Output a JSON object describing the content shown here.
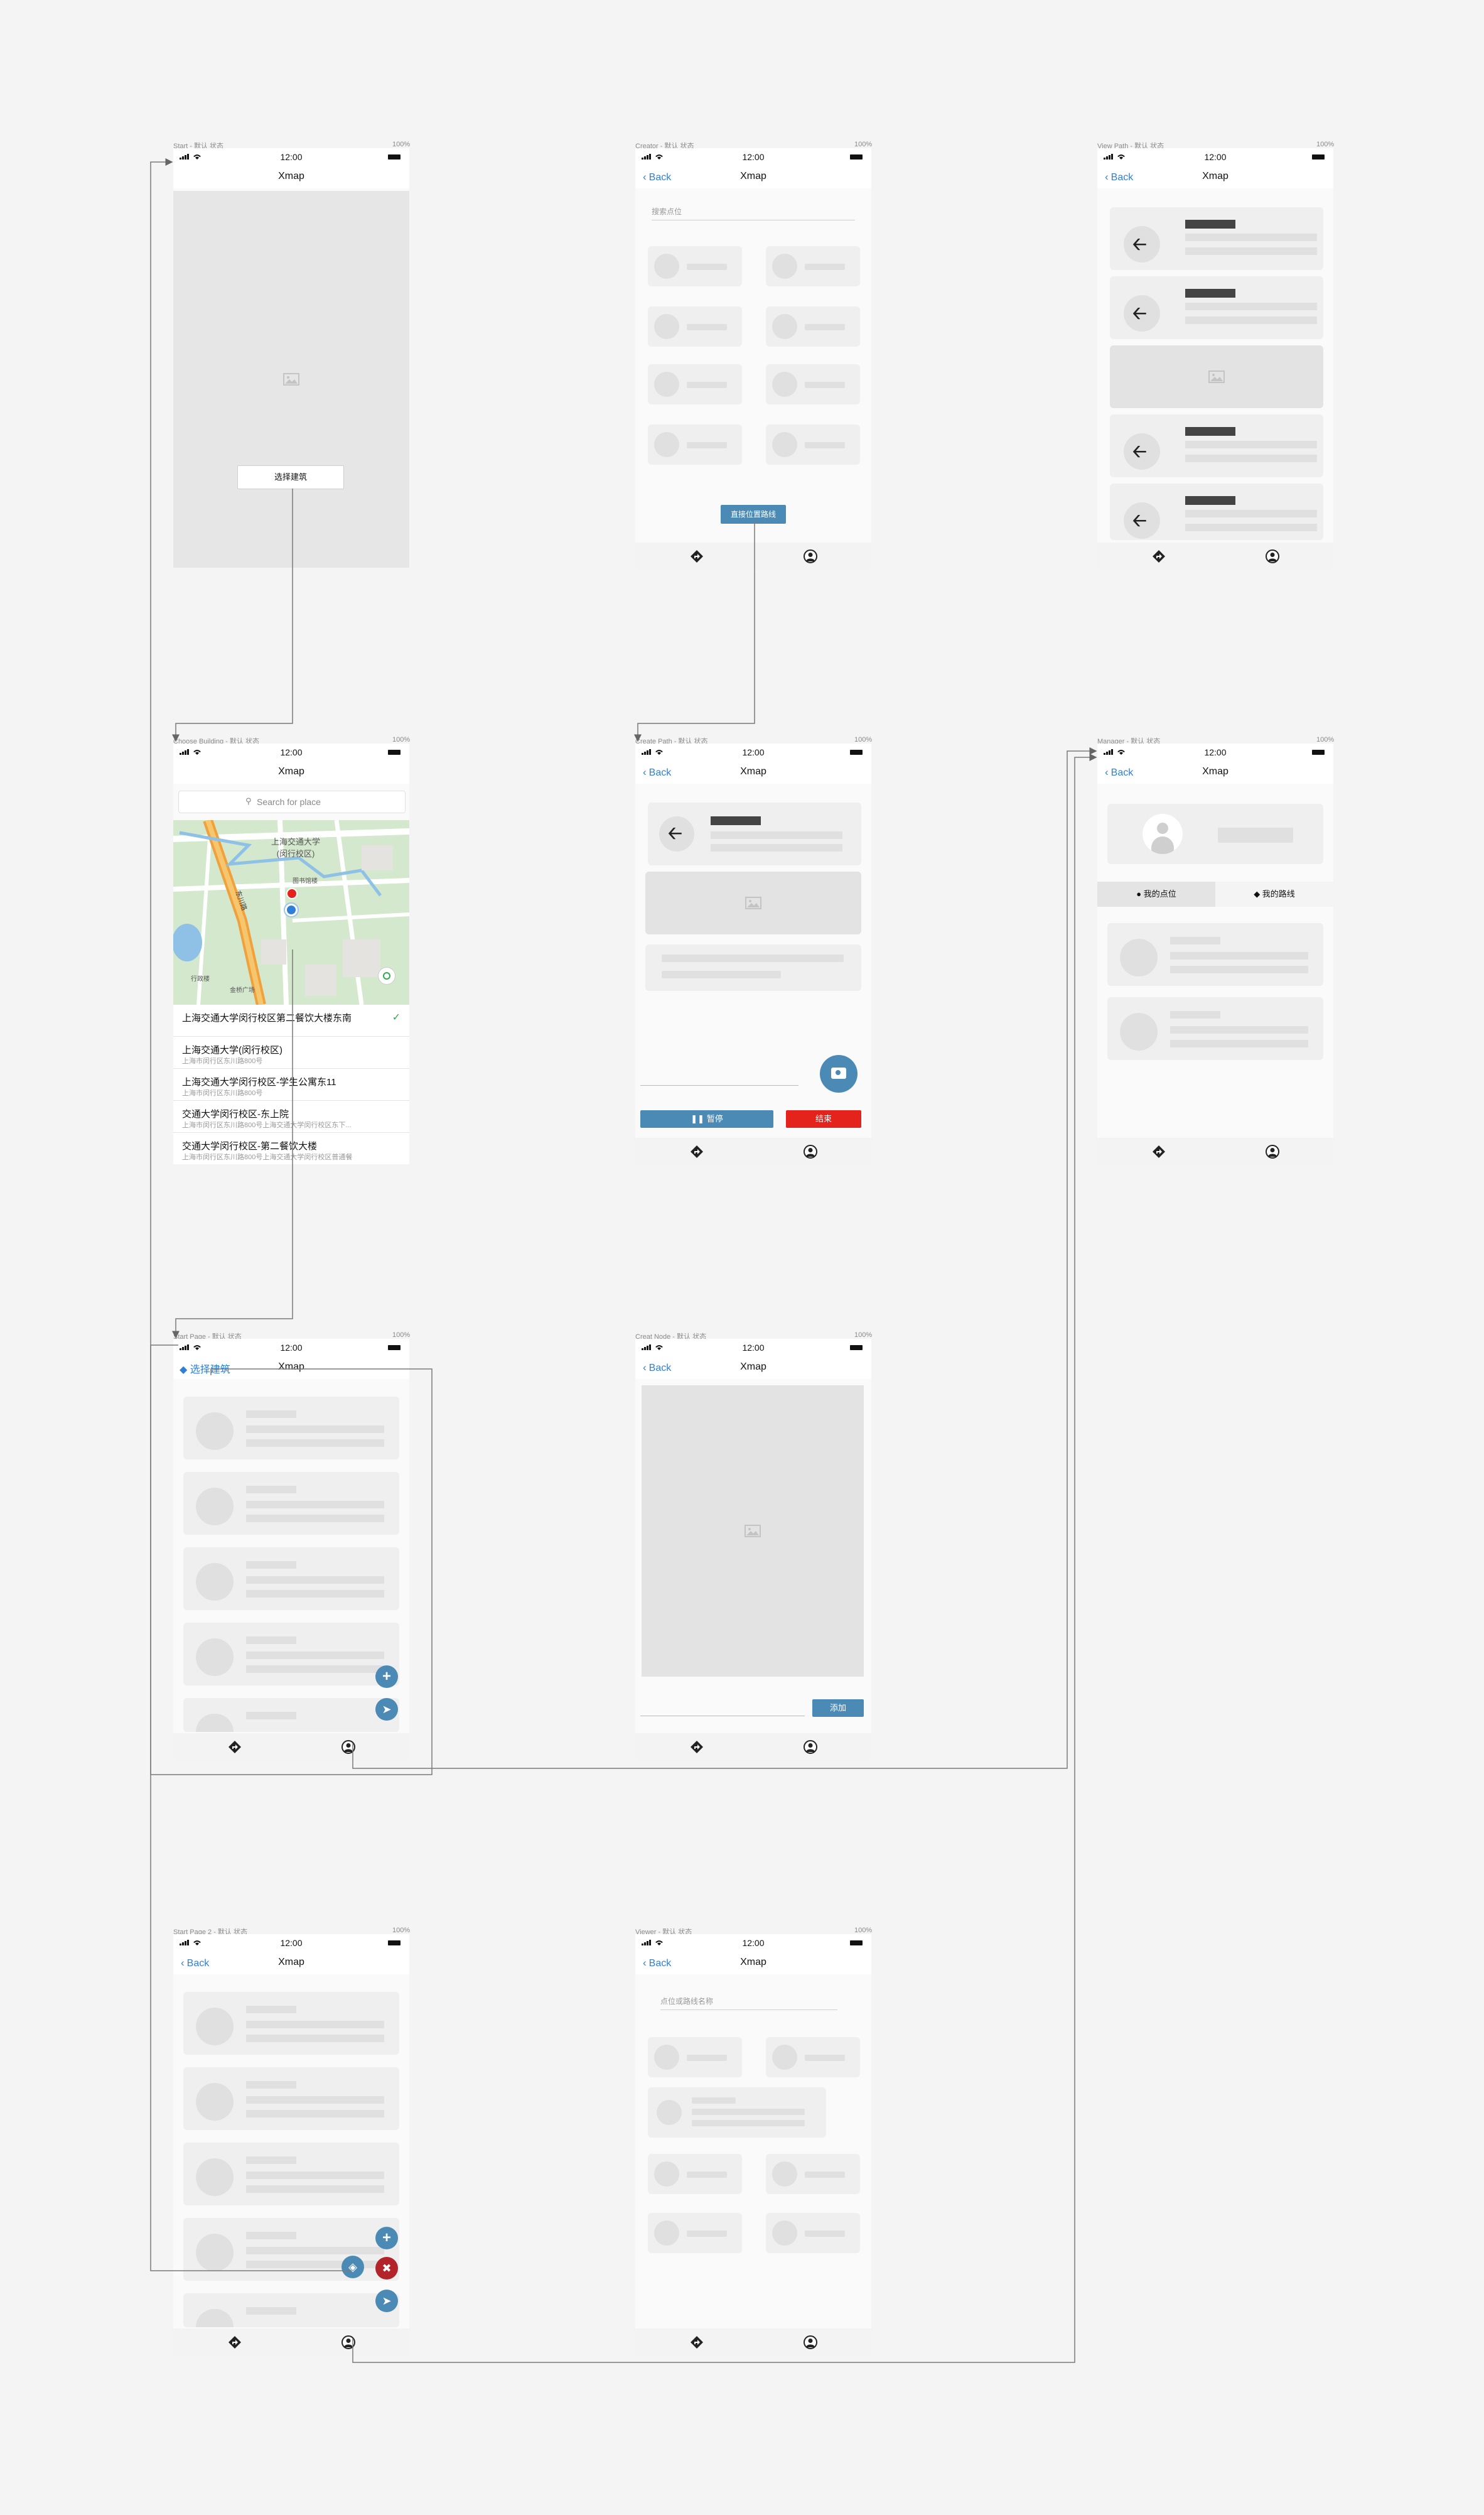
{
  "status": {
    "time": "12:00",
    "battery": "100%"
  },
  "app_title": "Xmap",
  "back_label": "Back",
  "frames": {
    "start": "Start - 默认 状态",
    "creator": "Creator - 默认 状态",
    "view_path": "View Path - 默认 状态",
    "choose_building": "Choose Building - 默认 状态",
    "create_path": "Create Path - 默认 状态",
    "manager": "Manager - 默认 状态",
    "start_page": "Start Page - 默认 状态",
    "creat_node": "Creat Node - 默认 状态",
    "start_page_2": "Start Page 2 - 默认 状态",
    "viewer": "Viewer - 默认 状态"
  },
  "start": {
    "select_button": "选择建筑"
  },
  "creator": {
    "search_placeholder": "搜索点位",
    "connect_button": "直接位置路线"
  },
  "choose_building": {
    "search_placeholder": "Search for place",
    "map_labels": {
      "campus": "上海交通大学\n(闵行校区)",
      "library": "图书馆楼",
      "road": "东川路",
      "plaza": "金桥广场",
      "road2": "行政楼"
    },
    "places": [
      {
        "name": "上海交通大学闵行校区第二餐饮大楼东南",
        "address": "",
        "selected": true
      },
      {
        "name": "上海交通大学(闵行校区)",
        "address": "上海市闵行区东川路800号"
      },
      {
        "name": "上海交通大学闵行校区-学生公寓东11",
        "address": "上海市闵行区东川路800号"
      },
      {
        "name": "交通大学闵行校区-东上院",
        "address": "上海市闵行区东川路800号上海交通大学闵行校区东下..."
      },
      {
        "name": "交通大学闵行校区-第二餐饮大楼",
        "address": "上海市闵行区东川路800号上海交通大学闵行校区普通餐"
      }
    ]
  },
  "create_path": {
    "pause_button": "暂停",
    "end_button": "结束"
  },
  "manager": {
    "tab_points": "我的点位",
    "tab_routes": "我的路线"
  },
  "start_page": {
    "select_link": "选择建筑"
  },
  "creat_node": {
    "add_button": "添加"
  },
  "viewer": {
    "search_placeholder": "点位或路线名称"
  },
  "colors": {
    "accent": "#4c8ab6",
    "link": "#2f7fd6",
    "danger": "#e3231c",
    "placeholder": "#e6e6e6"
  }
}
